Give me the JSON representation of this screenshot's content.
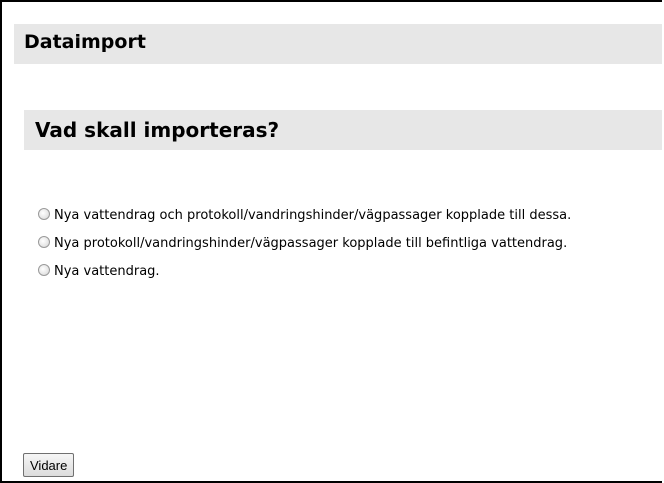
{
  "header": {
    "title": "Dataimport"
  },
  "section": {
    "title": "Vad skall importeras?"
  },
  "options": [
    {
      "label": "Nya vattendrag och protokoll/vandringshinder/vägpassager kopplade till dessa.",
      "selected": false
    },
    {
      "label": "Nya protokoll/vandringshinder/vägpassager kopplade till befintliga vattendrag.",
      "selected": false
    },
    {
      "label": "Nya vattendrag.",
      "selected": false
    }
  ],
  "actions": {
    "next_label": "Vidare"
  }
}
